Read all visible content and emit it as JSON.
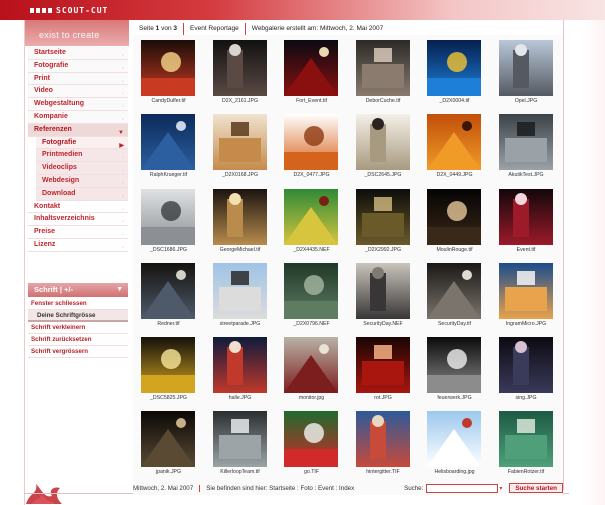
{
  "header": {
    "logo_text": "SCOUT-CUT",
    "slogan": "exist to create"
  },
  "nav": {
    "items": [
      {
        "label": "Startseite",
        "level": 0
      },
      {
        "label": "Fotografie",
        "level": 0
      },
      {
        "label": "Print",
        "level": 0
      },
      {
        "label": "Video",
        "level": 0
      },
      {
        "label": "Webgestaltung",
        "level": 0
      },
      {
        "label": "Kompanie",
        "level": 0
      },
      {
        "label": "Referenzen",
        "level": 0,
        "active": true
      },
      {
        "label": "Fotografie",
        "level": 1,
        "active": true
      },
      {
        "label": "Printmedien",
        "level": 1
      },
      {
        "label": "Videoclips",
        "level": 1
      },
      {
        "label": "Webdesign",
        "level": 1
      },
      {
        "label": "Download",
        "level": 1
      },
      {
        "label": "Kontakt",
        "level": 0
      },
      {
        "label": "Inhaltsverzeichnis",
        "level": 0
      },
      {
        "label": "Preise",
        "level": 0
      },
      {
        "label": "Lizenz",
        "level": 0
      }
    ]
  },
  "font_menu": {
    "header": "Schrift | +/-",
    "close": "Fenster schliessen",
    "your_size": "Deine Schriftgrösse",
    "enlarge": "Schrift vergrössern",
    "reset": "Schrift zurücksetzen",
    "reduce": "Schrift verkleinern"
  },
  "topbar": {
    "page_prefix": "Seite",
    "page_current": "1",
    "page_of": "von",
    "page_total": "3",
    "gallery_name": "Event Reportage",
    "created": "Webgalerie erstellt am: Mittwoch, 2. Mai 2007"
  },
  "gallery": {
    "items": [
      {
        "caption": "CandyDulfer.tif",
        "colors": [
          "#1a0d08",
          "#c83a22",
          "#f6d78a"
        ]
      },
      {
        "caption": "D2X_2161.JPG",
        "colors": [
          "#111111",
          "#5b4a44",
          "#d9d4cf"
        ]
      },
      {
        "caption": "Fort_Event.tif",
        "colors": [
          "#0a0a12",
          "#8a1010",
          "#e8d9b0"
        ]
      },
      {
        "caption": "DeborCuche.tif",
        "colors": [
          "#2c2a28",
          "#8a7b6e",
          "#d6c8b8"
        ]
      },
      {
        "caption": "_D2X0004.tif",
        "colors": [
          "#05204f",
          "#1d7fd8",
          "#f2c531"
        ]
      },
      {
        "caption": "Opel.JPG",
        "colors": [
          "#b9c7d8",
          "#555a62",
          "#e3e6ea"
        ]
      },
      {
        "caption": "RalphKrueger.tif",
        "colors": [
          "#0b2a5a",
          "#2c5fa0",
          "#c8d6ea"
        ]
      },
      {
        "caption": "_D2X0168.JPG",
        "colors": [
          "#efe3cf",
          "#c58b4a",
          "#5a3a1e"
        ]
      },
      {
        "caption": "D2X_0477.JPG",
        "colors": [
          "#ffffff",
          "#d6631b",
          "#8c3a12"
        ]
      },
      {
        "caption": "_DSC2645.JPG",
        "colors": [
          "#f4f0e8",
          "#a89a80",
          "#2a2420"
        ]
      },
      {
        "caption": "D2X_0449.JPG",
        "colors": [
          "#c14f0a",
          "#f09a28",
          "#3a1604"
        ]
      },
      {
        "caption": "AkutikTest.JPG",
        "colors": [
          "#3c4348",
          "#9aa2a8",
          "#1a1d20"
        ]
      },
      {
        "caption": "_DSC1686.JPG",
        "colors": [
          "#dfe2e4",
          "#8c9094",
          "#3a3c3e"
        ]
      },
      {
        "caption": "GeorgeMichael.tif",
        "colors": [
          "#1a1410",
          "#b98c4e",
          "#f2e0b0"
        ]
      },
      {
        "caption": "_D2X4435.NEF",
        "colors": [
          "#2f8a36",
          "#d7c53e",
          "#7a1f16"
        ]
      },
      {
        "caption": "_D2X2992.JPG",
        "colors": [
          "#0d0d0a",
          "#6a5a2a",
          "#c9b37a"
        ]
      },
      {
        "caption": "MoulinRouge.tif",
        "colors": [
          "#050404",
          "#3a2818",
          "#e7c79a"
        ]
      },
      {
        "caption": "Event.tif",
        "colors": [
          "#12070a",
          "#9c1a2a",
          "#f5d6dc"
        ]
      },
      {
        "caption": "Redner.tif",
        "colors": [
          "#15130f",
          "#4e5a6a",
          "#d3d0c8"
        ]
      },
      {
        "caption": "streetparade.JPG",
        "colors": [
          "#9fc3e6",
          "#dcdcdc",
          "#2a2a2a"
        ]
      },
      {
        "caption": "_D2X0796.NEF",
        "colors": [
          "#203828",
          "#5d7c62",
          "#a8b8a0"
        ]
      },
      {
        "caption": "SecurityDay.NEF",
        "colors": [
          "#c9c4bc",
          "#383636",
          "#7e7a74"
        ]
      },
      {
        "caption": "SecurityDay.tif",
        "colors": [
          "#1a1816",
          "#7a746c",
          "#e0dcd4"
        ]
      },
      {
        "caption": "IngramMicro.JPG",
        "colors": [
          "#1c4c8c",
          "#e8a34c",
          "#f4f4f4"
        ]
      },
      {
        "caption": "_DSC5825.JPG",
        "colors": [
          "#14100a",
          "#d2a420",
          "#f6e79a"
        ]
      },
      {
        "caption": "halle.JPG",
        "colors": [
          "#0f1b3c",
          "#c0392b",
          "#f0e0d0"
        ]
      },
      {
        "caption": "monitor.jpg",
        "colors": [
          "#b9b2a6",
          "#7c1e1e",
          "#e8e1d6"
        ]
      },
      {
        "caption": "rot.JPG",
        "colors": [
          "#1a0504",
          "#a8160e",
          "#f4b082"
        ]
      },
      {
        "caption": "feuerwerk.JPG",
        "colors": [
          "#0a0a0a",
          "#8c8c8c",
          "#f0f0f0"
        ]
      },
      {
        "caption": "sing.JPG",
        "colors": [
          "#0c0a12",
          "#3a3a5a",
          "#d8c0d0"
        ]
      },
      {
        "caption": "jpanik.JPG",
        "colors": [
          "#0a0806",
          "#5a4a34",
          "#c8b08a"
        ]
      },
      {
        "caption": "KillerloopTeam.tif",
        "colors": [
          "#2a2e30",
          "#9ca4a8",
          "#e6eaec"
        ]
      },
      {
        "caption": "go.TIF",
        "colors": [
          "#1f6a2e",
          "#d02a2a",
          "#f2f2f2"
        ]
      },
      {
        "caption": "hintergitter.TIF",
        "colors": [
          "#2d5a9a",
          "#c84a3a",
          "#e8d8c0"
        ]
      },
      {
        "caption": "Helisboarding.jpg",
        "colors": [
          "#9cc8ee",
          "#ffffff",
          "#c0392b"
        ]
      },
      {
        "caption": "FabienRotzer.tif",
        "colors": [
          "#1d5a44",
          "#4fa07a",
          "#d8e6d8"
        ]
      }
    ]
  },
  "footer": {
    "date": "Mittwoch, 2. Mai 2007",
    "location_prefix": "Sie befinden sind hier:",
    "crumbs": [
      "Startseite",
      "Foto",
      "Event",
      "Index"
    ],
    "search_label": "Suche:",
    "search_value": "",
    "search_button": "Suche starten"
  },
  "colors": {
    "brand_red": "#c0242c",
    "header_gradient_start": "#b8111b",
    "nav_active_bg": "#eed8d8"
  }
}
